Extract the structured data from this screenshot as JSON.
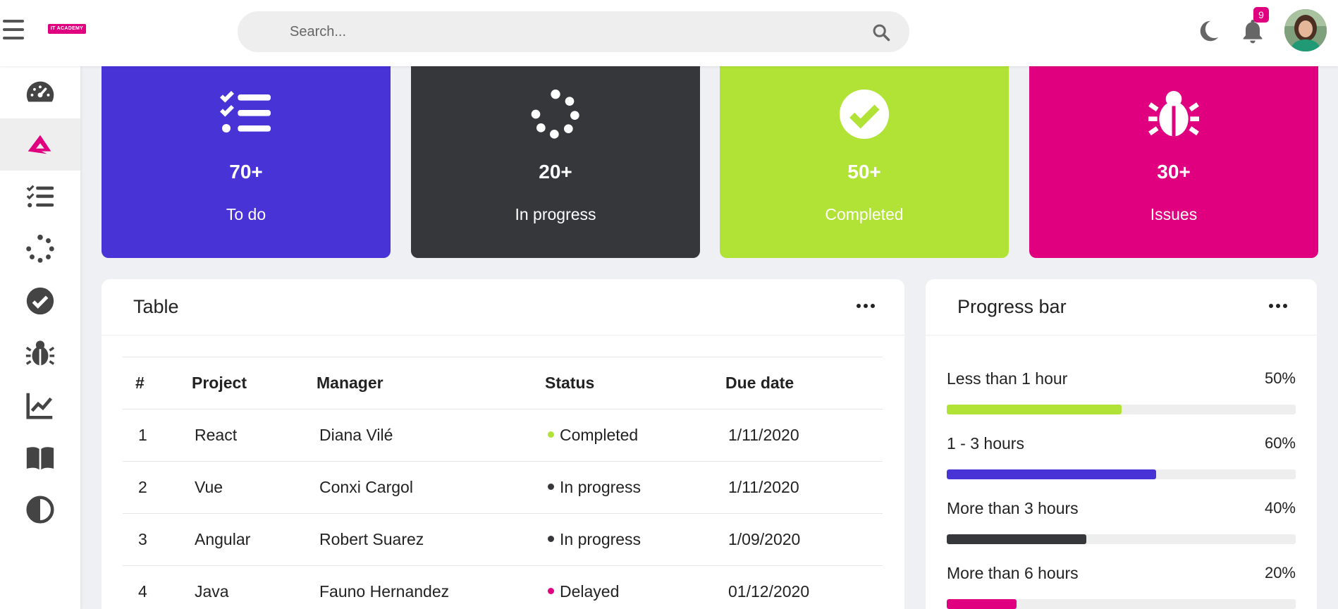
{
  "header": {
    "logo_text": "IT ACADEMY",
    "search_placeholder": "Search...",
    "notification_count": "9"
  },
  "sidebar": {
    "items": [
      {
        "icon": "dashboard-gauge-icon"
      },
      {
        "icon": "academy-logo-icon",
        "active": true
      },
      {
        "icon": "todo-list-icon"
      },
      {
        "icon": "in-progress-spinner-icon"
      },
      {
        "icon": "completed-check-icon"
      },
      {
        "icon": "bug-icon"
      },
      {
        "icon": "chart-line-icon"
      },
      {
        "icon": "book-icon"
      },
      {
        "icon": "contrast-icon"
      }
    ]
  },
  "stats": [
    {
      "count": "70+",
      "label": "To do",
      "color": "#4733d6",
      "icon": "checklist-icon"
    },
    {
      "count": "20+",
      "label": "In progress",
      "color": "#35373b",
      "icon": "spinner-icon"
    },
    {
      "count": "50+",
      "label": "Completed",
      "color": "#b1e236",
      "icon": "check-circle-icon"
    },
    {
      "count": "30+",
      "label": "Issues",
      "color": "#e0007f",
      "icon": "bug-icon"
    }
  ],
  "table_panel": {
    "title": "Table",
    "columns": [
      "#",
      "Project",
      "Manager",
      "Status",
      "Due date"
    ],
    "rows": [
      {
        "num": "1",
        "project": "React",
        "manager": "Diana Vilé",
        "status": "Completed",
        "status_color": "#b1e236",
        "due": "1/11/2020"
      },
      {
        "num": "2",
        "project": "Vue",
        "manager": "Conxi Cargol",
        "status": "In progress",
        "status_color": "#35373b",
        "due": "1/11/2020"
      },
      {
        "num": "3",
        "project": "Angular",
        "manager": "Robert Suarez",
        "status": "In progress",
        "status_color": "#35373b",
        "due": "1/09/2020"
      },
      {
        "num": "4",
        "project": "Java",
        "manager": "Fauno Hernandez",
        "status": "Delayed",
        "status_color": "#e0007f",
        "due": "01/12/2020"
      }
    ]
  },
  "progress_panel": {
    "title": "Progress bar",
    "items": [
      {
        "label": "Less than 1 hour",
        "percent_text": "50%",
        "value": 50,
        "color": "#b1e236"
      },
      {
        "label": "1 - 3 hours",
        "percent_text": "60%",
        "value": 60,
        "color": "#4733d6"
      },
      {
        "label": "More than 3 hours",
        "percent_text": "40%",
        "value": 40,
        "color": "#35373b"
      },
      {
        "label": "More than 6 hours",
        "percent_text": "20%",
        "value": 20,
        "color": "#e0007f"
      }
    ]
  }
}
